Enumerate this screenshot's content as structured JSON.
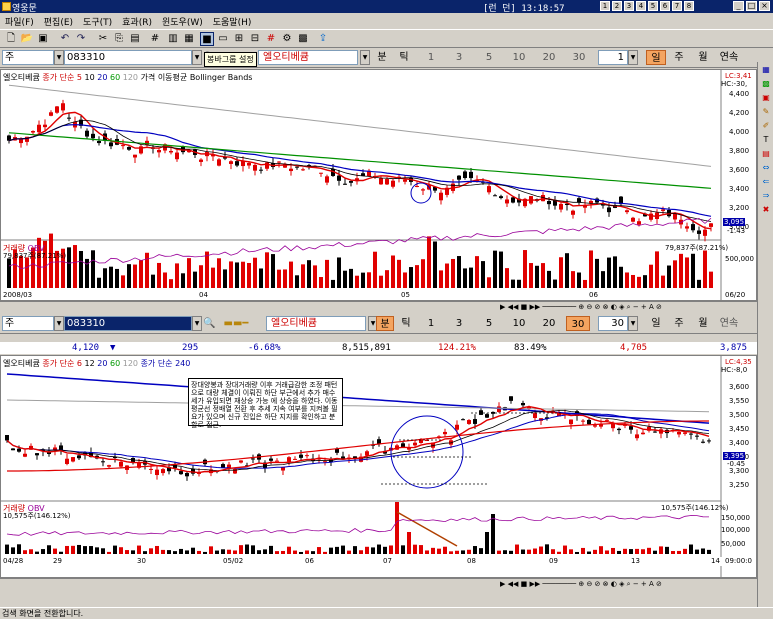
{
  "window": {
    "title": "영웅문",
    "status": "[런 던] 13:18:57",
    "top_buttons": [
      "1",
      "2",
      "3",
      "4",
      "5",
      "6",
      "7",
      "8"
    ],
    "win_buttons": [
      "_",
      "□",
      "×"
    ]
  },
  "menu": [
    "파일(F)",
    "편집(E)",
    "도구(T)",
    "효과(R)",
    "윈도우(W)",
    "도움말(H)"
  ],
  "toolbar": {
    "tooltip": "봉바그룹 설정"
  },
  "top_chart": {
    "stock_label": "주",
    "code": "083310",
    "name": "엘오티베큠",
    "unit_options": [
      "분",
      "틱"
    ],
    "periods": [
      "1",
      "3",
      "5",
      "10",
      "20",
      "30"
    ],
    "period_select": "1",
    "spans": [
      "일",
      "주",
      "월",
      "연속"
    ],
    "active_span": "일",
    "legend": {
      "name": "엘오티베큠",
      "ma": "종가 단순 5",
      "ma_vals": [
        "10",
        "20",
        "60",
        "120"
      ],
      "extra": "가격 이동평균",
      "bb": "Bollinger Bands"
    },
    "y_ticks": [
      "4,400",
      "4,200",
      "4,000",
      "3,800",
      "3,600",
      "3,400",
      "3,200",
      "3,000"
    ],
    "lc_label": "LC:3,41",
    "hc_label": "HC:-30,",
    "last_price": "3,095",
    "last_change": "-1.43",
    "vol_legend": {
      "name": "거래량",
      "obv": "OBV"
    },
    "vol_info": "79,837주(87.21%)",
    "vol_info_right": "79,837주(87.21%)",
    "vol_ticks": [
      "500,000"
    ],
    "dates": [
      "2008/03",
      "04",
      "05",
      "06",
      "06/20"
    ]
  },
  "bottom_chart": {
    "stock_label": "주",
    "code": "083310",
    "name": "엘오티베큠",
    "unit_options": [
      "분",
      "틱"
    ],
    "periods": [
      "1",
      "3",
      "5",
      "10",
      "20",
      "30"
    ],
    "active_period": "30",
    "period_select": "30",
    "spans": [
      "일",
      "주",
      "월",
      "연속"
    ],
    "stats": [
      "4,120",
      "▼",
      "295",
      "-6.68%",
      "8,515,891",
      "124.21%",
      "83.49%",
      "4,705",
      "3,875"
    ],
    "legend": {
      "name": "엘오티베큠",
      "ma": "종가 단순 6",
      "ma_vals": [
        "12",
        "20",
        "60",
        "120"
      ],
      "extra": "종가 단순 240"
    },
    "annotation": "장대양봉과 장대거래량 이후 거래급감한 조정 패턴으로 대량 체결이 이뤄진 하단 부근에서 추가 매수세가 유입되면 재상승 가능 에 상승을 하였다. 이동평균선 정배열 전환 후 추세 지속 여부를 지켜볼 필요가 있으며 신규 진입은 하단 지지를 확인하고 분할로 접근.",
    "y_ticks": [
      "3,600",
      "3,550",
      "3,500",
      "3,450",
      "3,400",
      "3,350",
      "3,300",
      "3,250"
    ],
    "lc_label": "LC:4,35",
    "hc_label": "HC:-8,0",
    "last_price": "3,395",
    "last_change": "-0.45",
    "vol_legend": {
      "name": "거래량",
      "obv": "OBV"
    },
    "vol_info": "10,575주(146.12%)",
    "vol_info_right": "10,575주(146.12%)",
    "vol_ticks": [
      "150,000",
      "100,000",
      "50,000"
    ],
    "dates": [
      "04/28",
      "29",
      "30",
      "05/02",
      "06",
      "07",
      "08",
      "09",
      "13",
      "14",
      "09:00:0"
    ]
  },
  "statusbar": "검색 화면을 전환합니다."
}
